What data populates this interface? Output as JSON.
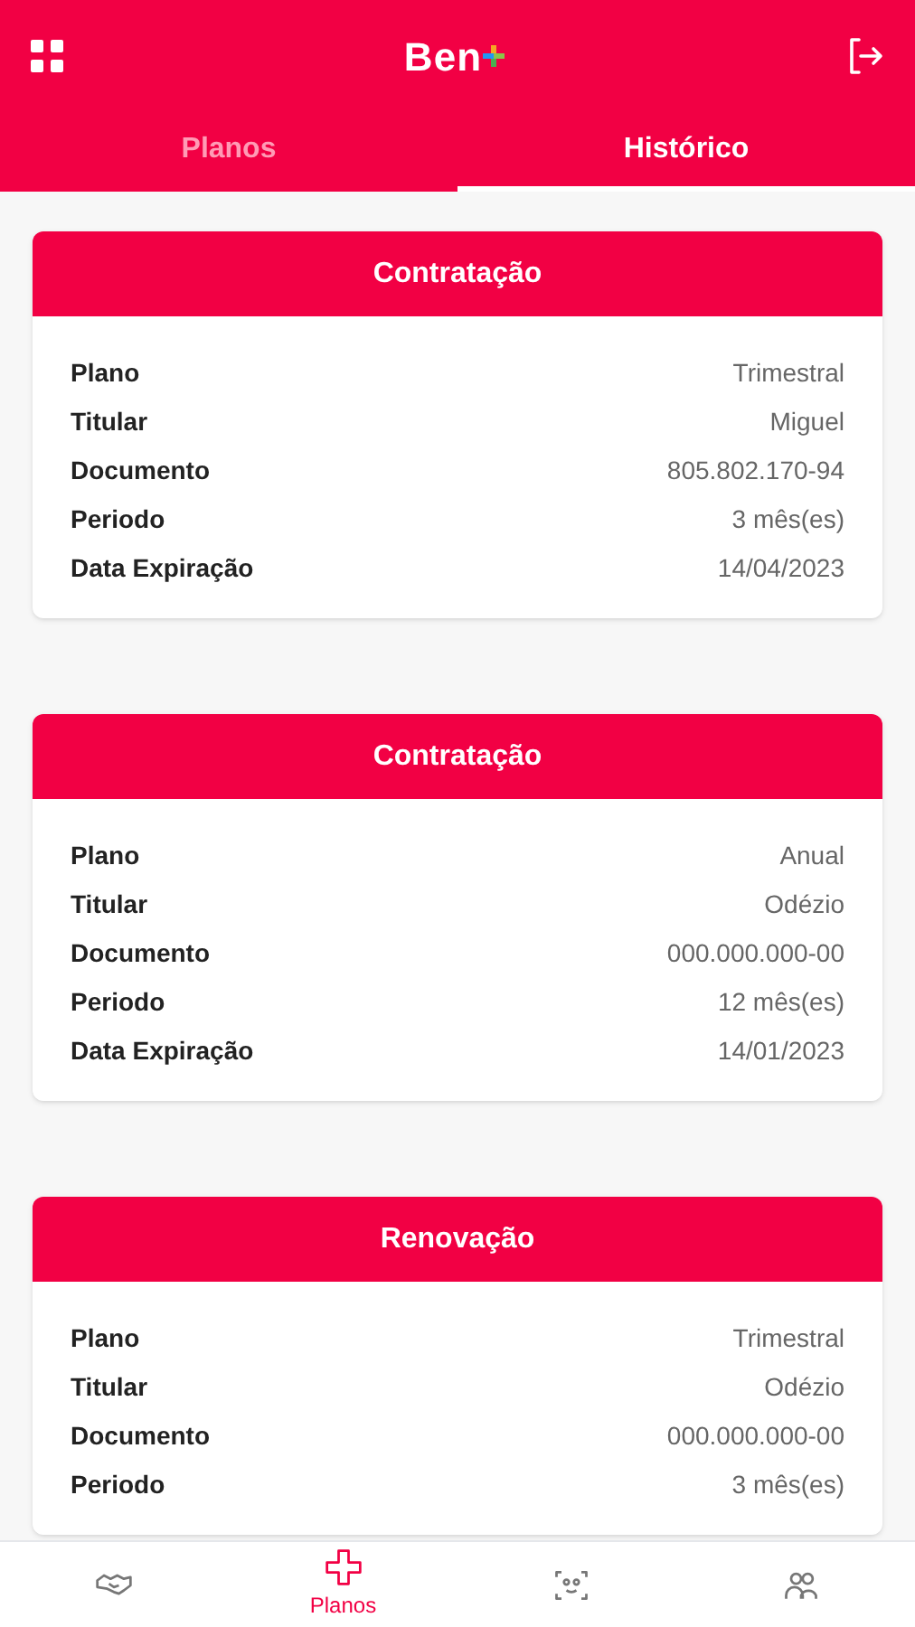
{
  "header": {
    "logo": "Ben"
  },
  "tabs": [
    {
      "label": "Planos",
      "selected": false
    },
    {
      "label": "Histórico",
      "selected": true
    }
  ],
  "cards": [
    {
      "title": "Contratação",
      "rows": [
        {
          "label": "Plano",
          "value": "Trimestral"
        },
        {
          "label": "Titular",
          "value": "Miguel"
        },
        {
          "label": "Documento",
          "value": "805.802.170-94"
        },
        {
          "label": "Periodo",
          "value": "3 mês(es)"
        },
        {
          "label": "Data Expiração",
          "value": "14/04/2023"
        }
      ]
    },
    {
      "title": "Contratação",
      "rows": [
        {
          "label": "Plano",
          "value": "Anual"
        },
        {
          "label": "Titular",
          "value": "Odézio"
        },
        {
          "label": "Documento",
          "value": "000.000.000-00"
        },
        {
          "label": "Periodo",
          "value": "12 mês(es)"
        },
        {
          "label": "Data Expiração",
          "value": "14/01/2023"
        }
      ]
    },
    {
      "title": "Renovação",
      "rows": [
        {
          "label": "Plano",
          "value": "Trimestral"
        },
        {
          "label": "Titular",
          "value": "Odézio"
        },
        {
          "label": "Documento",
          "value": "000.000.000-00"
        },
        {
          "label": "Periodo",
          "value": "3 mês(es)"
        }
      ]
    }
  ],
  "bottom_nav": [
    {
      "selected": false
    },
    {
      "label": "Planos",
      "selected": true
    },
    {
      "selected": false
    },
    {
      "selected": false
    }
  ]
}
